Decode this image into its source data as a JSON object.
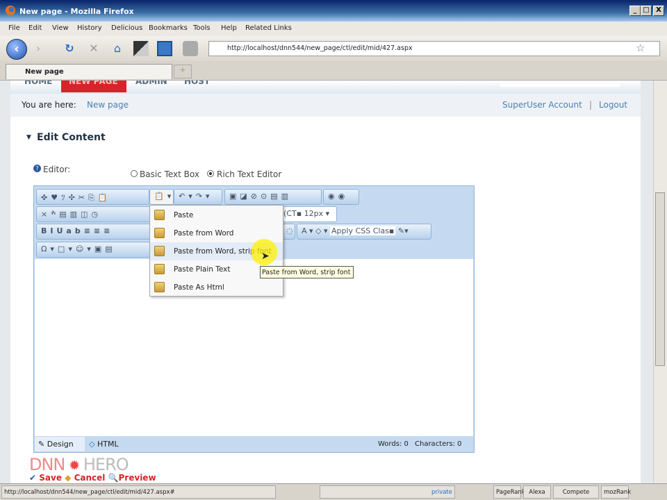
{
  "window": {
    "title": "New page - Mozilla Firefox",
    "controls": [
      "_",
      "□",
      "X"
    ]
  },
  "menubar": [
    "File",
    "Edit",
    "View",
    "History",
    "Delicious",
    "Bookmarks",
    "Tools",
    "Help",
    "Related Links"
  ],
  "url": "http://localhost/dnn544/new_page/ctl/edit/mid/427.aspx",
  "tab": {
    "label": "New page",
    "new_tab": "+"
  },
  "site_nav": [
    "HOME",
    "NEW PAGE",
    "ADMIN",
    "HOST"
  ],
  "breadcrumb": {
    "label": "You are here:",
    "page": "New page"
  },
  "user": {
    "account": "SuperUser Account",
    "sep": "|",
    "logout": "Logout"
  },
  "section": {
    "title": "Edit Content",
    "arrow": "▼"
  },
  "editor": {
    "label": "Editor:",
    "options": [
      "Basic Text Box",
      "Rich Text Editor"
    ],
    "selected": "Rich Text Editor"
  },
  "toolbar": {
    "font_size": "12px",
    "font_name": "(CT▪",
    "css_class": "Apply CSS Clas▪"
  },
  "paste_menu": [
    "Paste",
    "Paste from Word",
    "Paste from Word, strip font",
    "Paste Plain Text",
    "Paste As Html"
  ],
  "tooltip": "Paste from Word, strip font",
  "editor_footer": {
    "design": "Design",
    "html": "HTML",
    "words": "Words: 0",
    "characters": "Characters: 0"
  },
  "logo": {
    "left": "DNN",
    "right": "HERO"
  },
  "actions": {
    "save": "Save",
    "cancel": "Cancel",
    "preview": "Preview"
  },
  "statusbar": {
    "url": "http://localhost/dnn544/new_page/ctl/edit/mid/427.aspx#",
    "private": "private",
    "items": [
      "PageRank",
      "Alexa",
      "Compete",
      "mozRank"
    ]
  }
}
